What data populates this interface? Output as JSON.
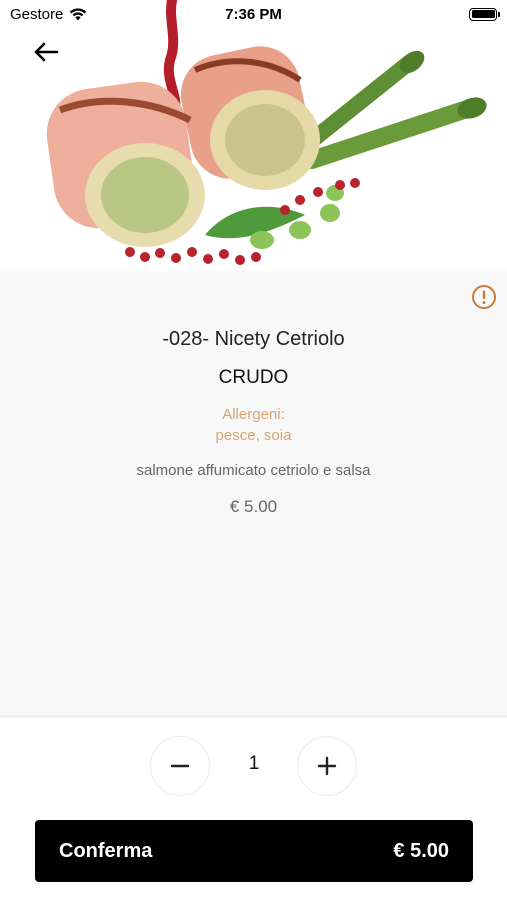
{
  "status_bar": {
    "carrier": "Gestore",
    "time": "7:36 PM"
  },
  "hero": {
    "image_icon": "sushi-roll-photo"
  },
  "product": {
    "name": "-028- Nicety Cetriolo",
    "category": "CRUDO",
    "allergen_label": "Allergeni:",
    "allergen_list": "pesce, soia",
    "description": "salmone affumicato cetriolo e salsa",
    "price": "€ 5.00"
  },
  "quantity": {
    "value": "1",
    "minus_icon": "minus-icon",
    "plus_icon": "plus-icon"
  },
  "confirm": {
    "label": "Conferma",
    "price": "€ 5.00"
  },
  "colors": {
    "accent": "#d8a475",
    "info_icon": "#c8793a",
    "button_bg": "#000000",
    "panel_bg": "#f7f8f7"
  }
}
